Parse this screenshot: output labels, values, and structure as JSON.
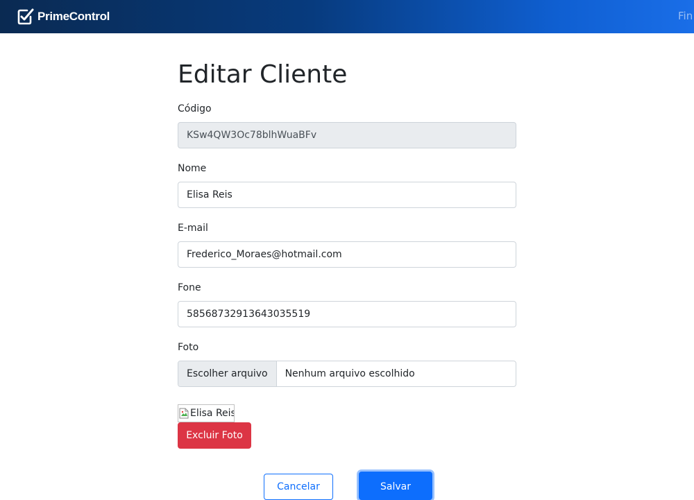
{
  "navbar": {
    "brand": "PrimeControl",
    "brand_icon": "checkbox-logo-icon",
    "link_partial": "Fin"
  },
  "page": {
    "title": "Editar Cliente"
  },
  "form": {
    "codigo": {
      "label": "Código",
      "value": "KSw4QW3Oc78blhWuaBFv"
    },
    "nome": {
      "label": "Nome",
      "value": "Elisa Reis"
    },
    "email": {
      "label": "E-mail",
      "value": "Frederico_Moraes@hotmail.com"
    },
    "fone": {
      "label": "Fone",
      "value": "58568732913643035519"
    },
    "foto": {
      "label": "Foto",
      "button_label": "Escolher arquivo",
      "status_text": "Nenhum arquivo escolhido"
    },
    "photo_alt": "Elisa Reis",
    "delete_photo_label": "Excluir Foto",
    "cancel_label": "Cancelar",
    "save_label": "Salvar"
  },
  "colors": {
    "primary": "#0d6efd",
    "danger": "#dc3545",
    "navbar_start": "#0a2a52",
    "navbar_end": "#1a6ee8"
  }
}
